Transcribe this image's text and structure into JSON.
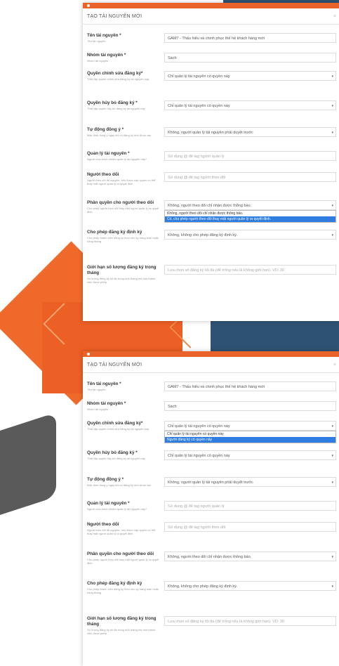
{
  "brand": {
    "orange": "#e8622a",
    "navy": "#2e5273",
    "highlight": "#2f7de1"
  },
  "panels": [
    {
      "title": "TẠO TÀI NGUYÊN MỚI",
      "close": "×",
      "fields": [
        {
          "label": "Tên tài nguyên *",
          "hint": "Tên tài nguyên",
          "type": "input",
          "value": "GAM7 - Thấu hiểu và chinh phục thế hệ khách hàng mới"
        },
        {
          "label": "Nhóm tài nguyên *",
          "hint": "Nhóm tài nguyên",
          "type": "input",
          "value": "Sách"
        },
        {
          "label": "Quyền chỉnh sửa đăng ký*",
          "hint": "Thiết lập quyền chỉnh sửa đăng ký tài nguyên này",
          "type": "select",
          "value": "Chỉ quản lý tài nguyên có quyền này"
        },
        {
          "label": "Quyền hủy bỏ đăng ký *",
          "hint": "Thiết lập quyền hủy bỏ đăng ký tài nguyên này",
          "type": "select",
          "value": "Chỉ quản lý tài nguyên có quyền này"
        },
        {
          "label": "Tự động đồng ý *",
          "hint": "Mặc định đồng ý ngay khi có đăng ký mới được tạo",
          "type": "select",
          "value": "Không, người quản lý tài nguyên phải duyệt trước"
        },
        {
          "label": "Quản lý tài nguyên *",
          "hint": "Người chịu trách nhiệm quản lý tài nguyên này?",
          "type": "input",
          "placeholder": "Sử dụng @ để tag người quản lý"
        },
        {
          "label": "Người theo dõi",
          "hint": "Người theo dõi tài nguyên, nếu được cấp quyền có thể thay mặt người quản lý ra quyết định",
          "type": "input",
          "placeholder": "Sử dụng @ để tag người theo dõi"
        },
        {
          "label": "Phân quyền cho người theo dõi",
          "hint": "Cho phép người theo dõi thay mặt người quản lý ra quyết định",
          "type": "select",
          "value": "Không, người theo dõi chỉ nhận được thông báo."
        },
        {
          "label": "Cho phép đăng ký định kỳ",
          "hint": "Cho phép thành viên đăng ký theo chu kỳ hàng tuần hoặc hàng tháng",
          "type": "select",
          "value": "Không, không cho phép đăng ký định kỳ."
        },
        {
          "label": "Giới hạn số lượng đăng ký trong tháng",
          "hint": "Số lượng đăng ký tối đa trong một tháng mà một thành viên được phép",
          "type": "input",
          "placeholder": "Lựa chọn số đăng ký tối đa (để trống nếu là không giới hạn). VD: 30"
        }
      ],
      "dropdown": {
        "field_index": 7,
        "options": [
          {
            "label": "Không, người theo dõi chỉ nhận được thông báo.",
            "selected": false
          },
          {
            "label": "Có, cho phép người theo dõi thay mặt người quản lý ra quyết định.",
            "selected": true
          }
        ]
      }
    },
    {
      "title": "TẠO TÀI NGUYÊN MỚI",
      "close": "×",
      "fields": [
        {
          "label": "Tên tài nguyên *",
          "hint": "Tên tài nguyên",
          "type": "input",
          "value": "GAM7 - Thấu hiểu và chinh phục thế hệ khách hàng mới"
        },
        {
          "label": "Nhóm tài nguyên *",
          "hint": "Nhóm tài nguyên",
          "type": "input",
          "value": "Sách"
        },
        {
          "label": "Quyền chỉnh sửa đăng ký*",
          "hint": "Thiết lập quyền chỉnh sửa đăng ký tài nguyên này",
          "type": "select",
          "value": "Chỉ quản lý tài nguyên có quyền này"
        },
        {
          "label": "Quyền hủy bỏ đăng ký *",
          "hint": "Thiết lập quyền hủy bỏ đăng ký tài nguyên này",
          "type": "select",
          "value": "Chỉ quản lý tài nguyên có quyền này"
        },
        {
          "label": "Tự động đồng ý *",
          "hint": "Mặc định đồng ý ngay khi có đăng ký mới được tạo",
          "type": "select",
          "value": "Không, người quản lý tài nguyên phải duyệt trước"
        },
        {
          "label": "Quản lý tài nguyên *",
          "hint": "Người chịu trách nhiệm quản lý tài nguyên này?",
          "type": "input",
          "placeholder": "Sử dụng @ để tag người quản lý"
        },
        {
          "label": "Người theo dõi",
          "hint": "Người theo dõi tài nguyên, nếu được cấp quyền có thể thay mặt người quản lý ra quyết định",
          "type": "input",
          "placeholder": "Sử dụng @ để tag người theo dõi"
        },
        {
          "label": "Phân quyền cho người theo dõi",
          "hint": "Cho phép người theo dõi thay mặt người quản lý ra quyết định",
          "type": "select",
          "value": "Không, người theo dõi chỉ nhận được thông báo."
        },
        {
          "label": "Cho phép đăng ký định kỳ",
          "hint": "Cho phép thành viên đăng ký theo chu kỳ hàng tuần hoặc hàng tháng",
          "type": "select",
          "value": "Không, không cho phép đăng ký định kỳ."
        },
        {
          "label": "Giới hạn số lượng đăng ký trong tháng",
          "hint": "Số lượng đăng ký tối đa trong một tháng mà một thành viên được phép",
          "type": "input",
          "placeholder": "Lựa chọn số đăng ký tối đa (để trống nếu là không giới hạn). VD: 30"
        }
      ],
      "dropdown": {
        "field_index": 2,
        "options": [
          {
            "label": "Chỉ quản lý tài nguyên có quyền này",
            "selected": false
          },
          {
            "label": "Người đăng ký có quyền này",
            "selected": true
          }
        ]
      }
    }
  ]
}
